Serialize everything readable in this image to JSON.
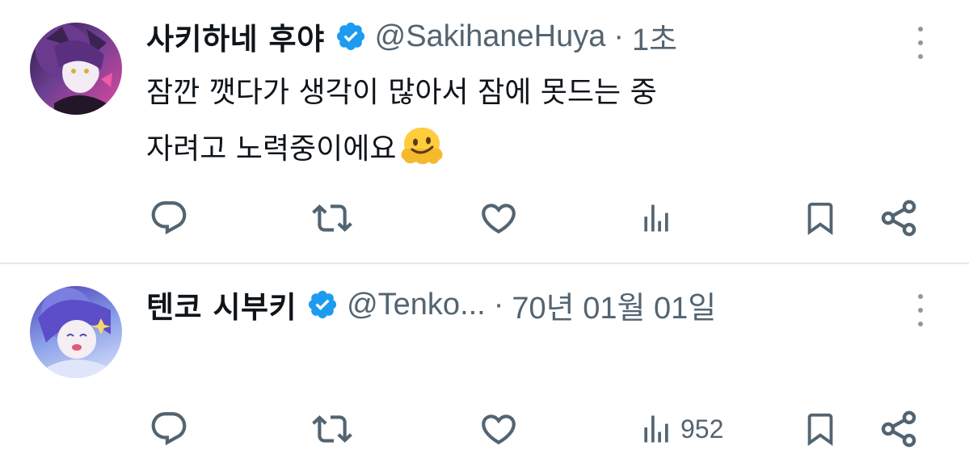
{
  "tweets": [
    {
      "name": "사키하네 후야",
      "handle": "@SakihaneHuya",
      "separator": "·",
      "time": "1초",
      "verified": true,
      "text_lines": [
        "잠깐 깻다가 생각이 많아서 잠에 못드는 중",
        "자려고 노력중이에요"
      ],
      "emoji": "melting-face",
      "actions": {
        "reply": {
          "icon": "reply-icon",
          "count": ""
        },
        "retweet": {
          "icon": "retweet-icon",
          "count": ""
        },
        "like": {
          "icon": "like-icon",
          "count": ""
        },
        "views": {
          "icon": "views-icon",
          "count": ""
        },
        "bookmark": {
          "icon": "bookmark-icon",
          "count": ""
        },
        "share": {
          "icon": "share-icon",
          "count": ""
        }
      }
    },
    {
      "name": "텐코 시부키",
      "handle": "@Tenko...",
      "separator": "·",
      "time": "70년 01월 01일",
      "verified": true,
      "text_lines": [],
      "actions": {
        "reply": {
          "icon": "reply-icon",
          "count": ""
        },
        "retweet": {
          "icon": "retweet-icon",
          "count": ""
        },
        "like": {
          "icon": "like-icon",
          "count": ""
        },
        "views": {
          "icon": "views-icon",
          "count": "952"
        },
        "bookmark": {
          "icon": "bookmark-icon",
          "count": ""
        },
        "share": {
          "icon": "share-icon",
          "count": ""
        }
      }
    }
  ],
  "colors": {
    "text_primary": "#0f1419",
    "text_secondary": "#536471",
    "verified_blue": "#1d9bf0",
    "divider": "#e6e9ec"
  }
}
